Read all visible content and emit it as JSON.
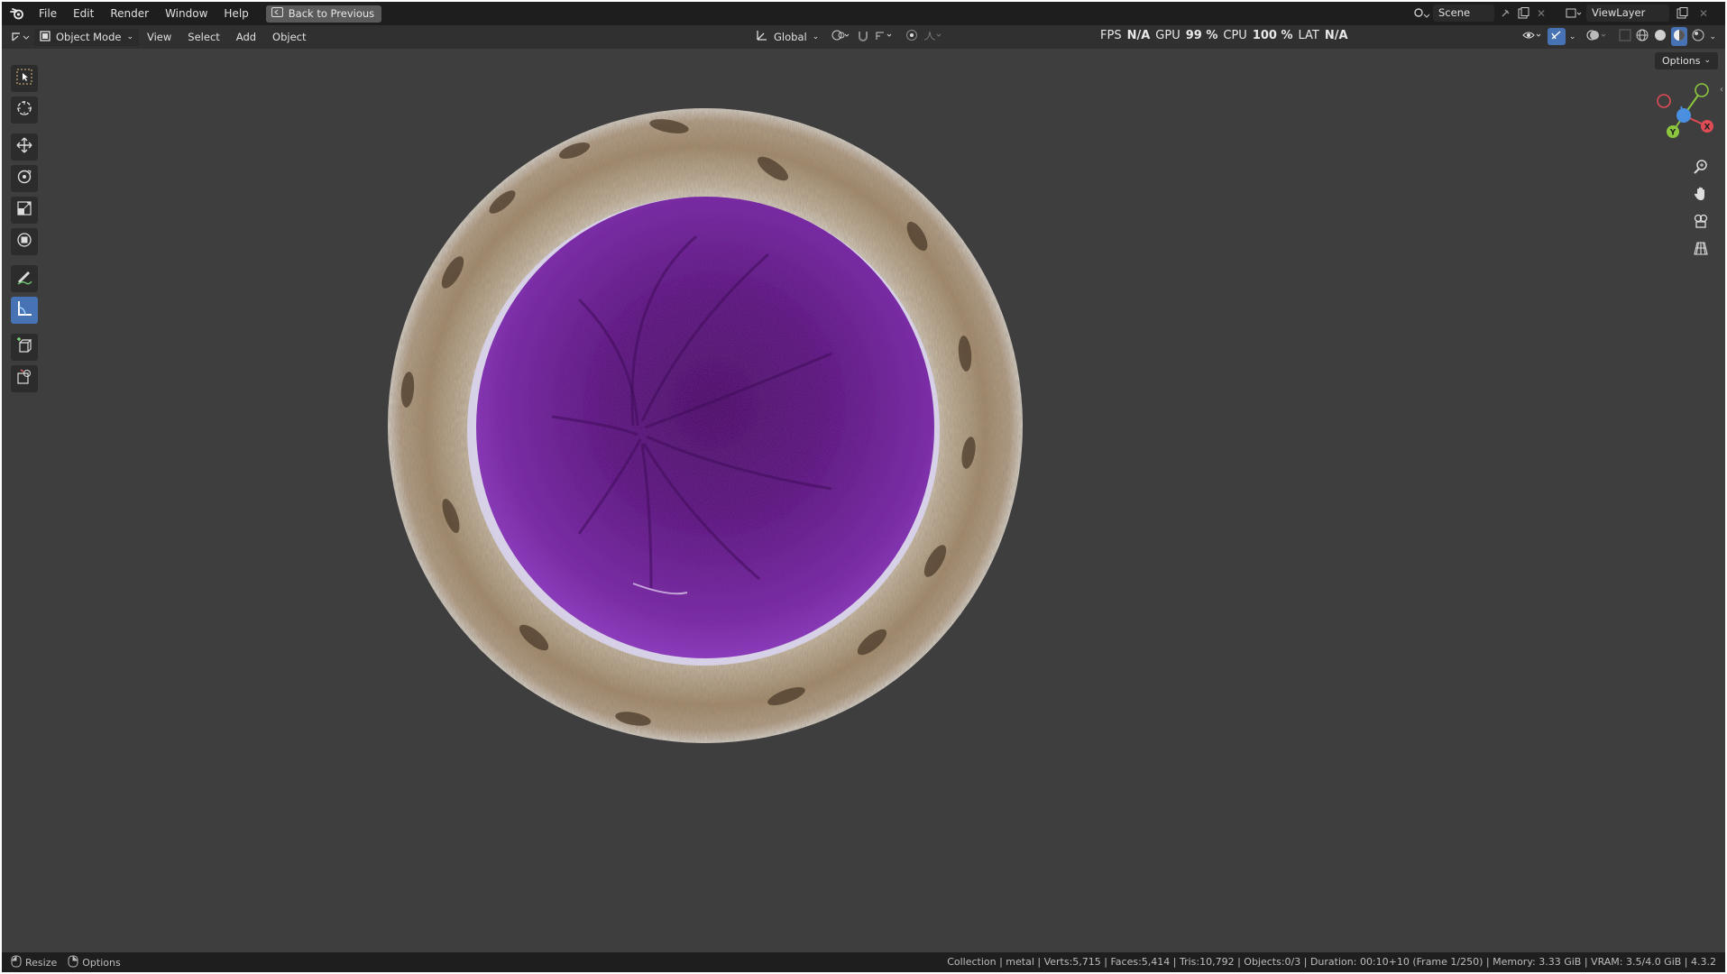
{
  "topbar": {
    "menus": [
      "File",
      "Edit",
      "Render",
      "Window",
      "Help"
    ],
    "back_label": "Back to Previous",
    "scene": "Scene",
    "view_layer": "ViewLayer"
  },
  "header": {
    "mode": "Object Mode",
    "menus": [
      "View",
      "Select",
      "Add",
      "Object"
    ],
    "transform_orientation": "Global",
    "options_label": "Options"
  },
  "stats": {
    "fps_label": "FPS",
    "fps_value": "N/A",
    "gpu_label": "GPU",
    "gpu_value": "99 %",
    "cpu_label": "CPU",
    "cpu_value": "100 %",
    "lat_label": "LAT",
    "lat_value": "N/A"
  },
  "status": {
    "left_1": "Resize",
    "left_2": "Options",
    "right": "Collection | metal | Verts:5,715 | Faces:5,414 | Tris:10,792 | Objects:0/3 | Duration: 00:10+10 (Frame 1/250) | Memory: 3.33 GiB | VRAM: 3.5/4.0 GiB | 4.3.2"
  },
  "colors": {
    "viewport_bg": "#3e3e3e",
    "accent": "#4772b3",
    "fur": "#a08a6c",
    "inner_purple": "#6a1a8c"
  },
  "gizmo_axes": {
    "x": "X",
    "y": "Y",
    "z": "Z"
  }
}
